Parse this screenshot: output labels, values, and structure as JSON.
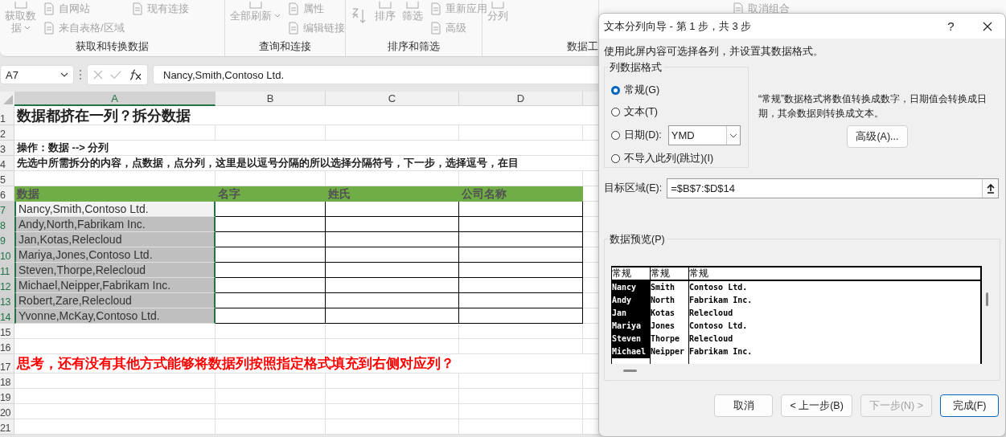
{
  "ribbon": {
    "groups": [
      {
        "label": "获取和转换数据",
        "columns": [
          [
            {
              "kind": "large",
              "lines": [
                "获取数",
                "据"
              ],
              "caret": true,
              "disabled": true
            }
          ],
          [
            {
              "kind": "small",
              "label": "自网站",
              "disabled": true
            },
            {
              "kind": "small",
              "label": "来自表格/区域",
              "disabled": true
            }
          ],
          [
            {
              "kind": "small",
              "label": "现有连接",
              "disabled": true
            }
          ]
        ]
      },
      {
        "label": "查询和连接",
        "columns": [
          [
            {
              "kind": "large",
              "lines": [
                "全部刷新"
              ],
              "caret": true,
              "disabled": true
            }
          ],
          [
            {
              "kind": "small",
              "label": "属性",
              "disabled": true
            },
            {
              "kind": "small",
              "label": "编辑链接",
              "disabled": true
            }
          ]
        ]
      },
      {
        "label": "排序和筛选",
        "columns": [
          [
            {
              "kind": "sort",
              "disabled": true
            }
          ],
          [
            {
              "kind": "large",
              "lines": [
                "排序"
              ],
              "caret": false,
              "disabled": true
            }
          ],
          [
            {
              "kind": "large",
              "lines": [
                "筛选"
              ],
              "caret": false,
              "disabled": true
            }
          ],
          [
            {
              "kind": "small",
              "label": "重新应用",
              "disabled": true
            },
            {
              "kind": "small",
              "label": "高级",
              "disabled": true
            }
          ]
        ]
      },
      {
        "label": "数据工",
        "columns": [
          [
            {
              "kind": "large",
              "lines": [
                "分列"
              ],
              "caret": false,
              "disabled": true
            }
          ]
        ]
      },
      {
        "columns": [
          [
            {
              "kind": "small",
              "label": "取消组合",
              "disabled": true
            }
          ]
        ]
      }
    ]
  },
  "formula_bar": {
    "name_box": "A7",
    "formula": "Nancy,Smith,Contoso Ltd."
  },
  "sheet": {
    "columns": [
      {
        "label": "A",
        "selected": true
      },
      {
        "label": "B",
        "selected": false
      },
      {
        "label": "C",
        "selected": false
      },
      {
        "label": "D",
        "selected": false
      }
    ],
    "rows": [
      {
        "number": "1",
        "kind": "title",
        "text": "数据都挤在一列？拆分数据"
      },
      {
        "number": "2",
        "kind": "empty"
      },
      {
        "number": "3",
        "kind": "bold",
        "text": "操作：数据 --> 分列"
      },
      {
        "number": "4",
        "kind": "bold",
        "text": "先选中所需拆分的内容，点数据，点分列，这里是以逗号分隔的所以选择分隔符号，下一步，选择逗号，在目"
      },
      {
        "number": "5",
        "kind": "empty"
      },
      {
        "number": "6",
        "kind": "header",
        "cells": [
          "数据",
          "名字",
          "姓氏",
          "公司名称"
        ]
      },
      {
        "number": "7",
        "kind": "data",
        "cells": [
          "Nancy,Smith,Contoso Ltd.",
          "",
          "",
          ""
        ],
        "selected": true,
        "active": true
      },
      {
        "number": "8",
        "kind": "data",
        "cells": [
          "Andy,North,Fabrikam Inc.",
          "",
          "",
          ""
        ],
        "selected": true,
        "active": false
      },
      {
        "number": "9",
        "kind": "data",
        "cells": [
          "Jan,Kotas,Relecloud",
          "",
          "",
          ""
        ],
        "selected": true,
        "active": false
      },
      {
        "number": "10",
        "kind": "data",
        "cells": [
          "Mariya,Jones,Contoso Ltd.",
          "",
          "",
          ""
        ],
        "selected": true,
        "active": false
      },
      {
        "number": "11",
        "kind": "data",
        "cells": [
          "Steven,Thorpe,Relecloud",
          "",
          "",
          ""
        ],
        "selected": true,
        "active": false
      },
      {
        "number": "12",
        "kind": "data",
        "cells": [
          "Michael,Neipper,Fabrikam Inc.",
          "",
          "",
          ""
        ],
        "selected": true,
        "active": false
      },
      {
        "number": "13",
        "kind": "data",
        "cells": [
          "Robert,Zare,Relecloud",
          "",
          "",
          ""
        ],
        "selected": true,
        "active": false
      },
      {
        "number": "14",
        "kind": "data",
        "cells": [
          "Yvonne,McKay,Contoso Ltd.",
          "",
          "",
          ""
        ],
        "selected": true,
        "active": false
      },
      {
        "number": "15",
        "kind": "empty"
      },
      {
        "number": "16",
        "kind": "empty"
      },
      {
        "number": "17",
        "kind": "note",
        "text": "思考，还有没有其他方式能够将数据列按照指定格式填充到右侧对应列？"
      },
      {
        "number": "18",
        "kind": "empty"
      },
      {
        "number": "19",
        "kind": "empty"
      },
      {
        "number": "20",
        "kind": "empty"
      },
      {
        "number": "21",
        "kind": "empty"
      }
    ]
  },
  "dialog": {
    "title": "文本分列向导 - 第 1 步，共 3 步",
    "help": "?",
    "instruction": "使用此屏内容可选择各列，并设置其数据格式。",
    "format_group": {
      "label": "列数据格式",
      "options": [
        {
          "kind": "plain",
          "label": "常规(G)",
          "selected": true
        },
        {
          "kind": "plain",
          "label": "文本(T)",
          "selected": false
        },
        {
          "kind": "date",
          "label": "日期(D):",
          "selected": false,
          "value": "YMD"
        },
        {
          "kind": "plain",
          "label": "不导入此列(跳过)(I)",
          "selected": false
        }
      ]
    },
    "description": "“常规”数据格式将数值转换成数字，日期值会转换成日期，其余数据则转换成文本。",
    "advanced_button": "高级(A)...",
    "destination": {
      "label": "目标区域(E):",
      "value": "=$B$7:$D$14"
    },
    "preview": {
      "label": "数据预览(P)",
      "columns": [
        {
          "header": "常规",
          "selected": true,
          "values": [
            "Nancy",
            "Andy",
            "Jan",
            "Mariya",
            "Steven",
            "Michael"
          ]
        },
        {
          "header": "常规",
          "selected": false,
          "values": [
            "Smith",
            "North",
            "Kotas",
            "Jones",
            "Thorpe",
            "Neipper"
          ]
        },
        {
          "header": "常规",
          "selected": false,
          "values": [
            "Contoso Ltd.",
            "Fabrikam Inc.",
            "Relecloud",
            "Contoso Ltd.",
            "Relecloud",
            "Fabrikam Inc."
          ]
        }
      ]
    },
    "buttons": [
      {
        "label": "取消",
        "disabled": false,
        "default": false
      },
      {
        "label": "< 上一步(B)",
        "disabled": false,
        "default": false
      },
      {
        "label": "下一步(N) >",
        "disabled": true,
        "default": false
      },
      {
        "label": "完成(F)",
        "disabled": false,
        "default": true
      }
    ]
  }
}
